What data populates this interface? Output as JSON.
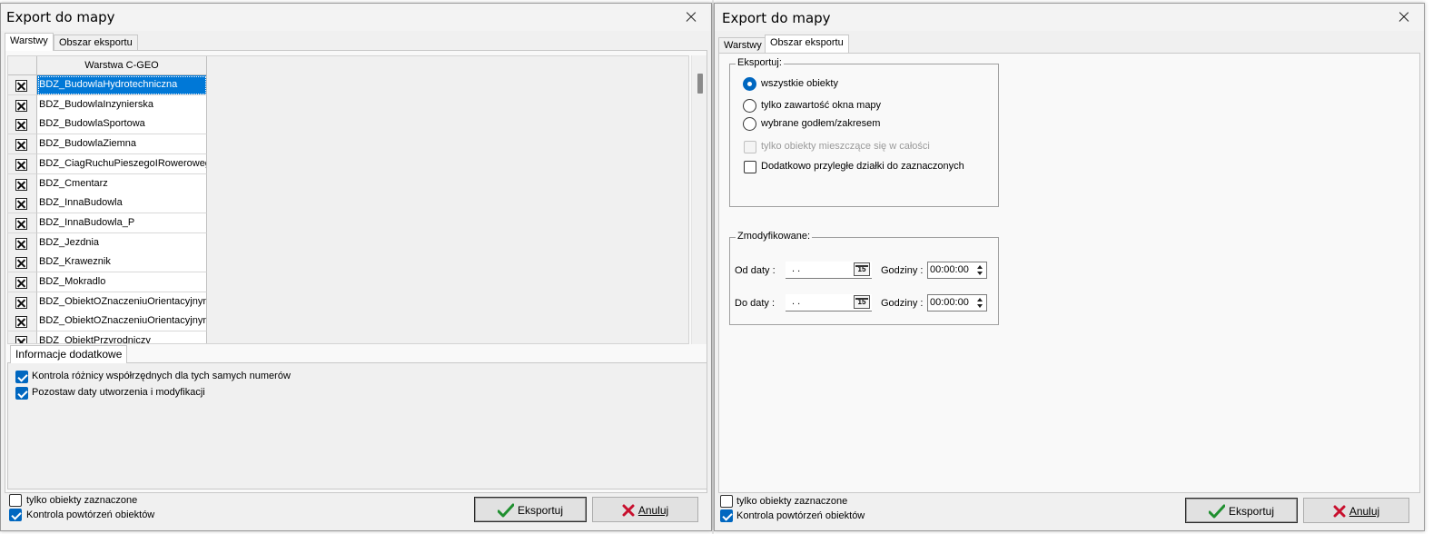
{
  "left": {
    "title": "Export do mapy",
    "tabs": [
      "Warstwy",
      "Obszar eksportu"
    ],
    "grid": {
      "header": "Warstwa C-GEO",
      "rows": [
        "BDZ_BudowlaHydrotechniczna",
        "BDZ_BudowlaInzynierska",
        "BDZ_BudowlaSportowa",
        "BDZ_BudowlaZiemna",
        "BDZ_CiagRuchuPieszegoIRowerowego",
        "BDZ_Cmentarz",
        "BDZ_InnaBudowla",
        "BDZ_InnaBudowla_P",
        "BDZ_Jezdnia",
        "BDZ_Kraweznik",
        "BDZ_Mokradlo",
        "BDZ_ObiektOZnaczeniuOrientacyjnymW",
        "BDZ_ObiektOZnaczeniuOrientacyjnymW",
        "BDZ_ObiektPrzyrodniczy"
      ]
    },
    "info_tab": "Informacje dodatkowe",
    "info_options": [
      "Kontrola różnicy współrzędnych dla tych samych numerów",
      "Pozostaw daty utworzenia i modyfikacji"
    ],
    "only_selected": "tylko obiekty zaznaczone",
    "duplicate_check": "Kontrola powtórzeń obiektów",
    "export_button": "Eksportuj",
    "cancel_button": "Anuluj"
  },
  "right": {
    "title": "Export do mapy",
    "tabs": [
      "Warstwy",
      "Obszar eksportu"
    ],
    "export_group": {
      "title": "Eksportuj:",
      "radios": [
        "wszystkie obiekty",
        "tylko zawartość okna mapy",
        "wybrane godłem/zakresem"
      ],
      "only_whole": "tylko obiekty mieszczące się w całości",
      "adjacent": "Dodatkowo przyległe działki do zaznaczonych"
    },
    "modified_group": {
      "title": "Zmodyfikowane:",
      "from_label": "Od daty :",
      "to_label": "Do daty :",
      "date_value": ". .",
      "cal_icon_text": "15",
      "hours_label": "Godziny :",
      "time_from": "00:00:00",
      "time_to": "00:00:00"
    },
    "only_selected": "tylko obiekty zaznaczone",
    "duplicate_check": "Kontrola powtórzeń obiektów",
    "export_button": "Eksportuj",
    "cancel_button": "Anuluj"
  }
}
